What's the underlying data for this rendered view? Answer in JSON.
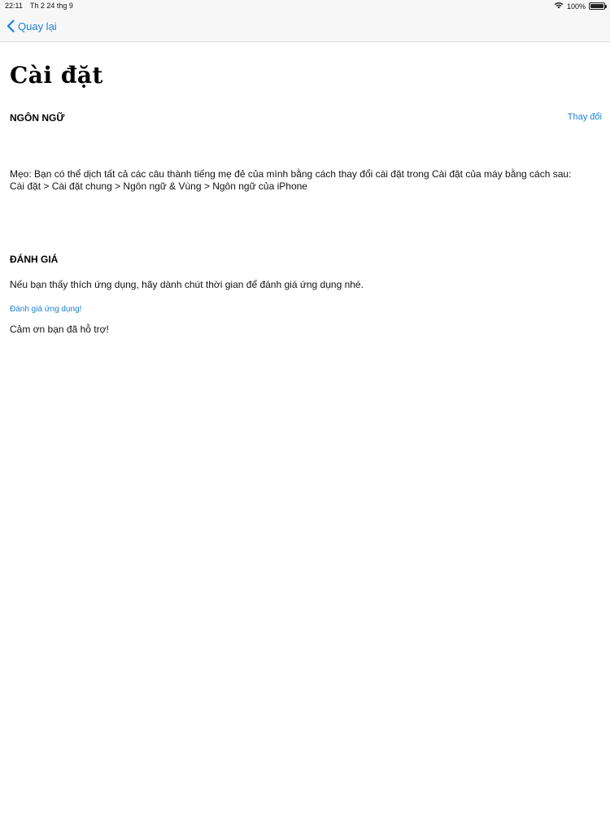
{
  "status_bar": {
    "time": "22:11",
    "date": "Th 2 24 thg 9",
    "battery_percent": "100%",
    "battery_level": 1.0
  },
  "nav": {
    "back_label": "Quay lại",
    "back_icon": "chevron-left-icon"
  },
  "page": {
    "title": "Cài đặt"
  },
  "language_section": {
    "header": "NGÔN NGỮ",
    "change_label": "Thay đổi",
    "tip_line1": "Mẹo: Bạn có thể dịch tất cả các câu thành tiếng mẹ đẻ của mình bằng cách thay đổi cài đặt trong Cài đặt của máy bằng cách sau:",
    "tip_line2": "Cài đặt > Cài đặt chung > Ngôn ngữ & Vùng > Ngôn ngữ của iPhone"
  },
  "review_section": {
    "header": "ĐÁNH GIÁ",
    "prompt": "Nếu bạn thấy thích ứng dụng, hãy dành chút thời gian để đánh giá ứng dụng nhé.",
    "link_label": "Đánh giá ứng dụng!",
    "thanks": "Cảm ơn bạn đã hỗ trợ!"
  },
  "colors": {
    "accent": "#1a82d6",
    "bar_background": "#f7f7f7"
  }
}
